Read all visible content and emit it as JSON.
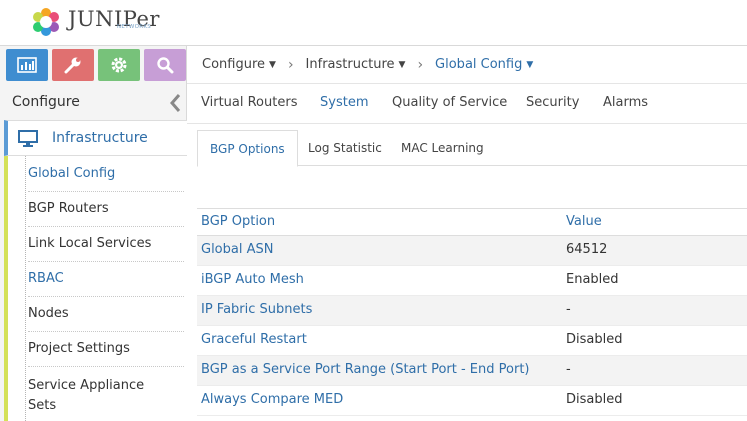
{
  "header": {
    "logo_text": "JUNIPer",
    "logo_sub": "NETWORKS"
  },
  "sidebar": {
    "title": "Configure",
    "section": "Infrastructure",
    "items": [
      {
        "label": "Global Config",
        "active": true
      },
      {
        "label": "BGP Routers",
        "active": false
      },
      {
        "label": "Link Local Services",
        "active": false
      },
      {
        "label": "RBAC",
        "active": true
      },
      {
        "label": "Nodes",
        "active": false
      },
      {
        "label": "Project Settings",
        "active": false
      },
      {
        "label": "Service Appliance\nSets",
        "active": false
      }
    ]
  },
  "breadcrumb": [
    "Configure",
    "Infrastructure",
    "Global Config"
  ],
  "tabs": [
    "Virtual Routers",
    "System",
    "Quality of Service",
    "Security",
    "Alarms"
  ],
  "active_tab": "System",
  "subtabs": [
    "BGP Options",
    "Log Statistic",
    "MAC Learning"
  ],
  "active_subtab": "BGP Options",
  "table": {
    "headers": [
      "BGP Option",
      "Value"
    ],
    "rows": [
      [
        "Global ASN",
        "64512"
      ],
      [
        "iBGP Auto Mesh",
        "Enabled"
      ],
      [
        "IP Fabric Subnets",
        "-"
      ],
      [
        "Graceful Restart",
        "Disabled"
      ],
      [
        "BGP as a Service Port Range (Start Port - End Port)",
        "-"
      ],
      [
        "Always Compare MED",
        "Disabled"
      ]
    ]
  },
  "colors": {
    "accent": "#2f6ea8",
    "monitor": "#3f8dd0",
    "configure": "#e07070",
    "settings": "#77c27a",
    "query": "#c79ed6",
    "sidebar_bar": "#d4e158"
  }
}
